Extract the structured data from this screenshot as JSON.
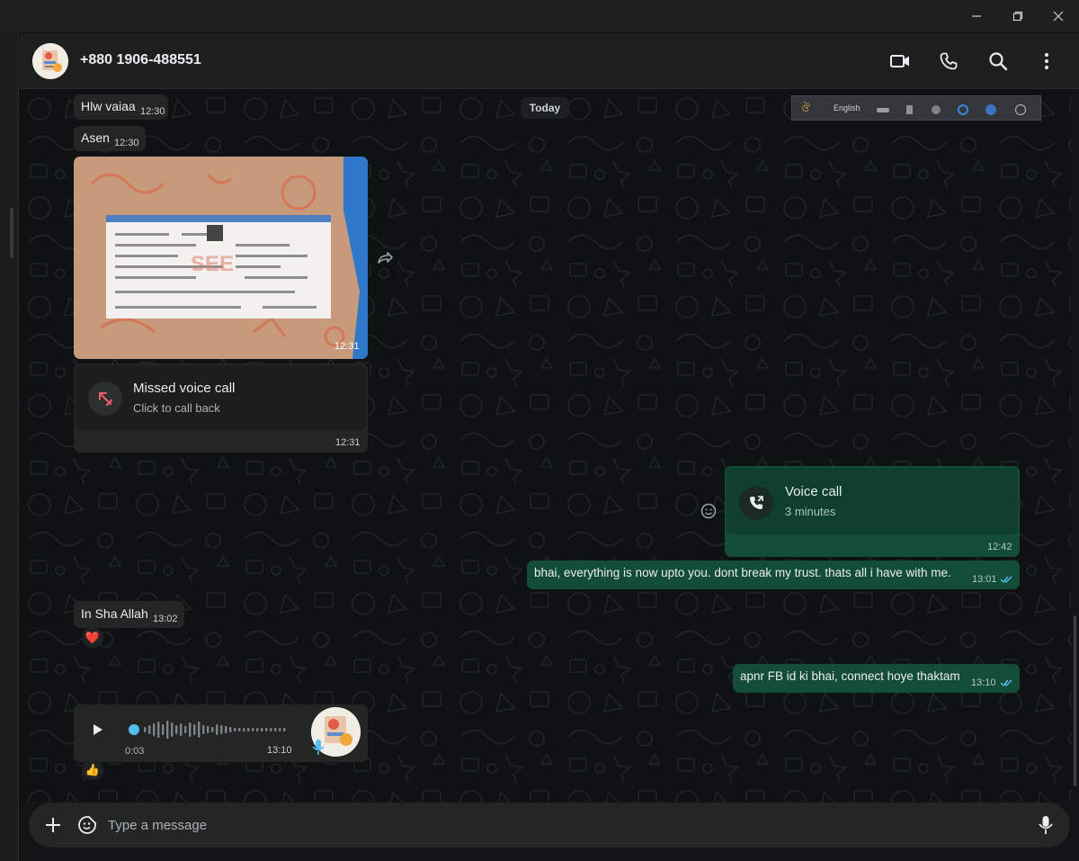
{
  "contact": {
    "name": "+880 1906-488551"
  },
  "header_icons": [
    "video-call-icon",
    "phone-icon",
    "search-icon",
    "menu-icon"
  ],
  "window_controls": [
    "minimize-icon",
    "restore-icon",
    "close-icon"
  ],
  "day_divider": "Today",
  "language_toolbar": {
    "language": "English"
  },
  "messages": {
    "m1": {
      "text": "Hlw vaiaa",
      "time": "12:30"
    },
    "m2": {
      "text": "Asen",
      "time": "12:30"
    },
    "photo": {
      "time": "12:31"
    },
    "missed_call": {
      "title": "Missed voice call",
      "subtitle": "Click to call back",
      "time": "12:31"
    },
    "voice_call": {
      "title": "Voice call",
      "subtitle": "3 minutes",
      "time": "12:42"
    },
    "m3": {
      "text": "bhai, everything is now upto you. dont break my trust. thats all i have with me.",
      "time": "13:01"
    },
    "m4": {
      "text": "In Sha Allah",
      "time": "13:02",
      "reaction": "❤️"
    },
    "m5": {
      "text": "apnr FB id ki bhai, connect hoye thaktam",
      "time": "13:10"
    },
    "voice_note": {
      "duration": "0:03",
      "time": "13:10",
      "reaction": "👍",
      "progress": 0.0
    }
  },
  "composer": {
    "placeholder": "Type a message"
  },
  "colors": {
    "outgoing_bubble": "#144d37",
    "incoming_bubble": "#242626",
    "missed_call_red": "#f15c6d",
    "read_tick": "#53bdeb"
  }
}
